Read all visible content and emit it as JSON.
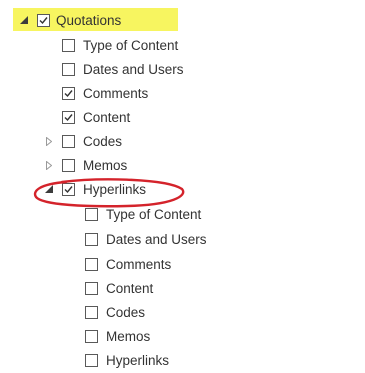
{
  "tree": {
    "root": {
      "label": "Quotations",
      "checked": true,
      "expanded": true
    },
    "children": [
      {
        "label": "Type of Content",
        "checked": false
      },
      {
        "label": "Dates and Users",
        "checked": false
      },
      {
        "label": "Comments",
        "checked": true
      },
      {
        "label": "Content",
        "checked": true
      },
      {
        "label": "Codes",
        "checked": false,
        "expandable": true
      },
      {
        "label": "Memos",
        "checked": false,
        "expandable": true
      },
      {
        "label": "Hyperlinks",
        "checked": true,
        "expanded": true
      }
    ],
    "hyperlinks_children": [
      {
        "label": "Type of Content",
        "checked": false
      },
      {
        "label": "Dates and Users",
        "checked": false
      },
      {
        "label": "Comments",
        "checked": false
      },
      {
        "label": "Content",
        "checked": false
      },
      {
        "label": "Codes",
        "checked": false
      },
      {
        "label": "Memos",
        "checked": false
      },
      {
        "label": "Hyperlinks",
        "checked": false
      }
    ]
  },
  "colors": {
    "highlight": "#f7f560",
    "annotation_ellipse": "#d4232b",
    "checkmark": "#333333"
  },
  "icons": {
    "expanded": "triangle-down-icon",
    "collapsed": "triangle-right-icon",
    "checkbox": "checkbox-icon"
  }
}
